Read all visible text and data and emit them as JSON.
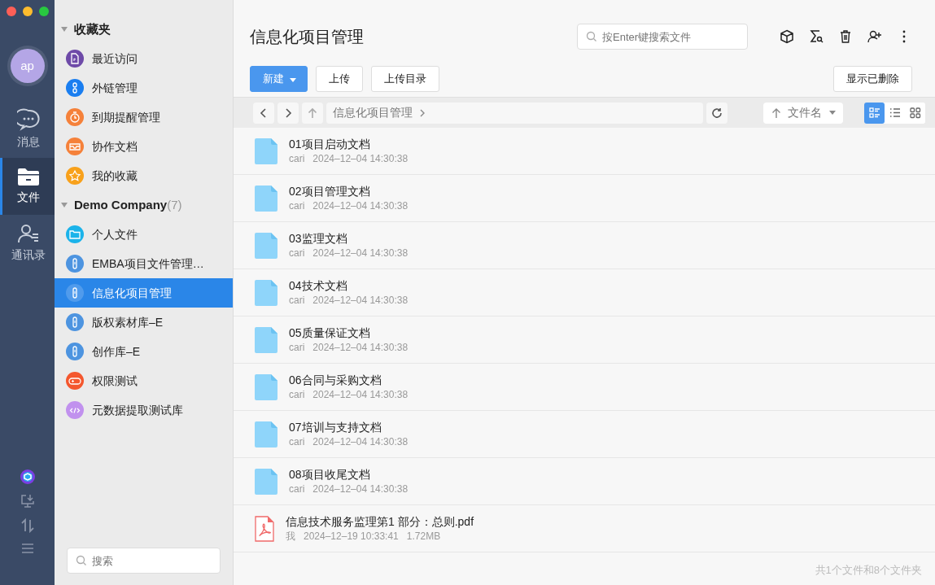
{
  "rail": {
    "avatar": "ap",
    "items": [
      {
        "label": "消息",
        "kind": "chat",
        "selected": false
      },
      {
        "label": "文件",
        "kind": "folder",
        "selected": true
      },
      {
        "label": "通讯录",
        "kind": "contacts",
        "selected": false
      }
    ]
  },
  "sidebar": {
    "sections": [
      {
        "title": "收藏夹",
        "expanded": true,
        "items": [
          {
            "label": "最近访问",
            "kind": "doc",
            "color": "#6e4aa8",
            "selected": false
          },
          {
            "label": "外链管理",
            "kind": "link",
            "color": "#1a7ef0",
            "selected": false
          },
          {
            "label": "到期提醒管理",
            "kind": "timer",
            "color": "#f5813a",
            "selected": false
          },
          {
            "label": "协作文档",
            "kind": "inbox",
            "color": "#f5813a",
            "selected": false
          },
          {
            "label": "我的收藏",
            "kind": "star",
            "color": "#f8a11b",
            "selected": false
          }
        ]
      },
      {
        "title": "Demo Company",
        "count": "(7)",
        "expanded": true,
        "items": [
          {
            "label": "个人文件",
            "kind": "folder",
            "color": "#1bb3ea",
            "selected": false
          },
          {
            "label": "EMBA项目文件管理…",
            "kind": "library",
            "color": "#4d94e0",
            "selected": false
          },
          {
            "label": "信息化项目管理",
            "kind": "library",
            "color": "#4d94e0",
            "selected": true
          },
          {
            "label": "版权素材库–E",
            "kind": "library",
            "color": "#4d94e0",
            "selected": false
          },
          {
            "label": "创作库–E",
            "kind": "library",
            "color": "#4d94e0",
            "selected": false
          },
          {
            "label": "权限测试",
            "kind": "gamepad",
            "color": "#f4572e",
            "selected": false
          },
          {
            "label": "元数据提取测试库",
            "kind": "code",
            "color": "#c191ee",
            "selected": false
          }
        ]
      }
    ],
    "search": {
      "placeholder": "搜索"
    }
  },
  "main": {
    "title": "信息化项目管理",
    "search": {
      "placeholder": "按Enter键搜索文件"
    },
    "buttons": [
      {
        "label": "新建",
        "kind": "primary"
      },
      {
        "label": "上传",
        "kind": "plain"
      },
      {
        "label": "上传目录",
        "kind": "plain"
      }
    ],
    "show_deleted": "显示已删除",
    "path": "信息化项目管理",
    "sort": "文件名",
    "views": [
      {
        "kind": "detail",
        "selected": true
      },
      {
        "kind": "list",
        "selected": false
      },
      {
        "kind": "grid",
        "selected": false
      }
    ],
    "files": [
      {
        "name": "01项目启动文档",
        "kind": "folder",
        "owner": "cari",
        "date": "2024–12–04 14:30:38"
      },
      {
        "name": "02项目管理文档",
        "kind": "folder",
        "owner": "cari",
        "date": "2024–12–04 14:30:38"
      },
      {
        "name": "03监理文档",
        "kind": "folder",
        "owner": "cari",
        "date": "2024–12–04 14:30:38"
      },
      {
        "name": "04技术文档",
        "kind": "folder",
        "owner": "cari",
        "date": "2024–12–04 14:30:38"
      },
      {
        "name": "05质量保证文档",
        "kind": "folder",
        "owner": "cari",
        "date": "2024–12–04 14:30:38"
      },
      {
        "name": "06合同与采购文档",
        "kind": "folder",
        "owner": "cari",
        "date": "2024–12–04 14:30:38"
      },
      {
        "name": "07培训与支持文档",
        "kind": "folder",
        "owner": "cari",
        "date": "2024–12–04 14:30:38"
      },
      {
        "name": "08项目收尾文档",
        "kind": "folder",
        "owner": "cari",
        "date": "2024–12–04 14:30:38"
      },
      {
        "name": "信息技术服务监理第1 部分：总则.pdf",
        "kind": "pdf",
        "owner": "我",
        "date": "2024–12–19 10:33:41",
        "size": "1.72MB"
      }
    ],
    "footer": "共1个文件和8个文件夹"
  }
}
